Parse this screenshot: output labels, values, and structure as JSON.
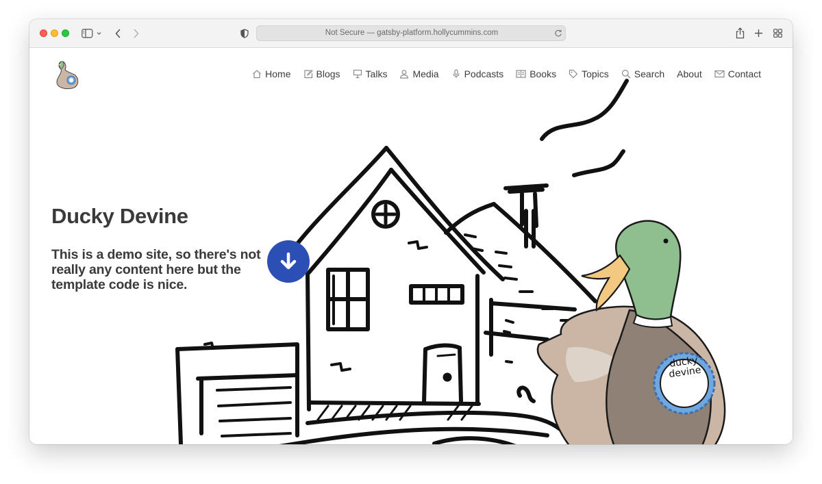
{
  "browser": {
    "address_text": "Not Secure — gatsby-platform.hollycummins.com",
    "icons": {
      "sidebar": "sidebar-icon",
      "back": "chevron-left-icon",
      "forward": "chevron-right-icon",
      "shield": "privacy-shield-icon",
      "reload": "reload-icon",
      "share": "share-icon",
      "new_tab": "plus-icon",
      "tab_overview": "grid-icon"
    }
  },
  "site": {
    "nav": [
      {
        "label": "Home",
        "icon": "home-icon"
      },
      {
        "label": "Blogs",
        "icon": "edit-icon"
      },
      {
        "label": "Talks",
        "icon": "presentation-icon"
      },
      {
        "label": "Media",
        "icon": "person-icon"
      },
      {
        "label": "Podcasts",
        "icon": "microphone-icon"
      },
      {
        "label": "Books",
        "icon": "book-icon"
      },
      {
        "label": "Topics",
        "icon": "tag-icon"
      },
      {
        "label": "Search",
        "icon": "search-icon"
      },
      {
        "label": "About",
        "icon": ""
      },
      {
        "label": "Contact",
        "icon": "envelope-icon"
      }
    ],
    "hero": {
      "title": "Ducky Devine",
      "subtitle": "This is a demo site, so there's not really any content here but the template code is nice.",
      "rosette_text_line1": "ducky",
      "rosette_text_line2": "devine"
    },
    "colors": {
      "accent": "#2b4fb4",
      "duck_head": "#8fbf8f",
      "duck_body": "#8f8175"
    }
  }
}
